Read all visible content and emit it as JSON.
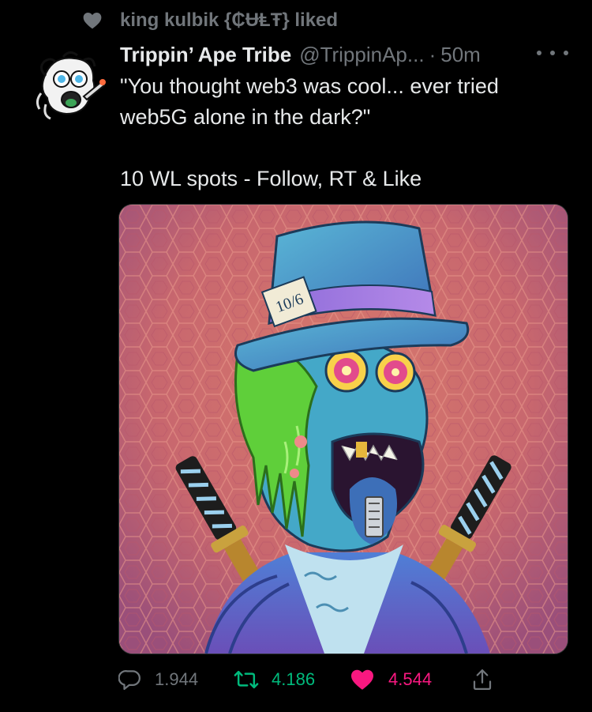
{
  "social_context": {
    "icon": "heart-icon",
    "text": "king kulbik {₵ɄⱠŦ} liked"
  },
  "tweet": {
    "author_name": "Trippin’ Ape Tribe",
    "author_handle": "@TrippinAp...",
    "separator": "·",
    "time": "50m",
    "text_line1": "\"You thought web3 was cool... ever tried",
    "text_line2": "web5G alone in the dark?\"",
    "text_line3": "10 WL spots - Follow, RT & Like",
    "hat_label": "10/6"
  },
  "actions": {
    "reply_count": "1.944",
    "retweet_count": "4.186",
    "like_count": "4.544"
  },
  "colors": {
    "background": "#000000",
    "text_primary": "#e7e9ea",
    "text_secondary": "#71767b",
    "retweet_green": "#00ba7c",
    "like_pink": "#f91880"
  }
}
